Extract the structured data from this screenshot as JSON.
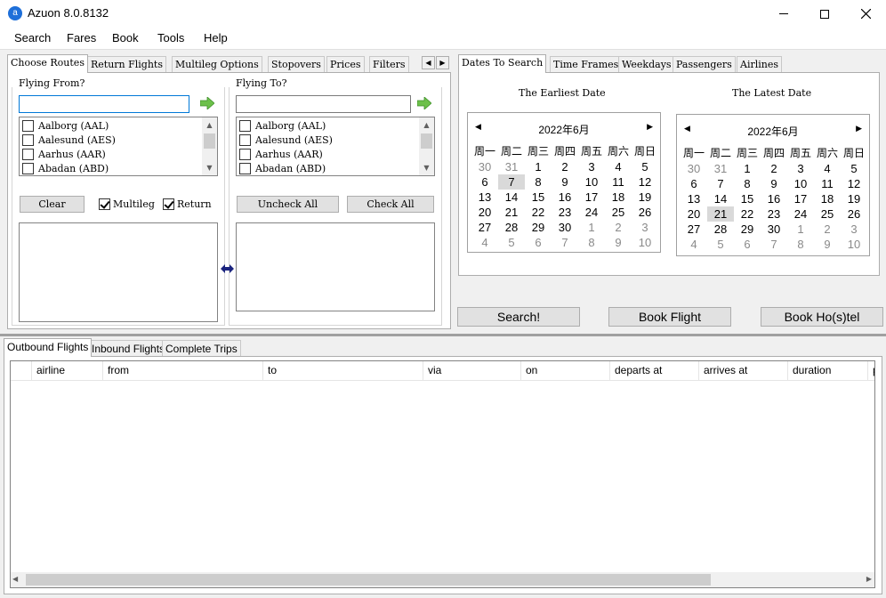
{
  "window": {
    "title": "Azuon 8.0.8132",
    "app_icon_glyph": "a",
    "controls": [
      "minimize-icon",
      "maximize-icon",
      "close-icon"
    ]
  },
  "menu": [
    "Search",
    "Fares",
    "Book",
    "Tools",
    "Help"
  ],
  "left_tabs": [
    "Choose Routes",
    "Return Flights",
    "Multileg Options",
    "Stopovers",
    "Prices",
    "Filters"
  ],
  "right_tabs": [
    "Dates To Search",
    "Time Frames",
    "Weekdays",
    "Passengers",
    "Airlines"
  ],
  "routes": {
    "from_label": "Flying From?",
    "to_label": "Flying To?",
    "from_value": "",
    "to_value": "",
    "airports": [
      "Aalborg (AAL)",
      "Aalesund (AES)",
      "Aarhus (AAR)",
      "Abadan (ABD)"
    ],
    "clear_label": "Clear",
    "multileg_label": "Multileg",
    "multileg_checked": true,
    "return_label": "Return",
    "return_checked": true,
    "uncheck_all_label": "Uncheck All",
    "check_all_label": "Check All",
    "arrow_color": "#4caf50",
    "swap_color": "#1a237e"
  },
  "dates": {
    "earliest_label": "The Earliest Date",
    "latest_label": "The Latest Date",
    "earliest": {
      "month_label": "2022年6月",
      "weekdays": [
        "周一",
        "周二",
        "周三",
        "周四",
        "周五",
        "周六",
        "周日"
      ],
      "days": [
        [
          "30",
          "31",
          "1",
          "2",
          "3",
          "4",
          "5"
        ],
        [
          "6",
          "7",
          "8",
          "9",
          "10",
          "11",
          "12"
        ],
        [
          "13",
          "14",
          "15",
          "16",
          "17",
          "18",
          "19"
        ],
        [
          "20",
          "21",
          "22",
          "23",
          "24",
          "25",
          "26"
        ],
        [
          "27",
          "28",
          "29",
          "30",
          "1",
          "2",
          "3"
        ],
        [
          "4",
          "5",
          "6",
          "7",
          "8",
          "9",
          "10"
        ]
      ],
      "selected": "7"
    },
    "latest": {
      "month_label": "2022年6月",
      "weekdays": [
        "周一",
        "周二",
        "周三",
        "周四",
        "周五",
        "周六",
        "周日"
      ],
      "days": [
        [
          "30",
          "31",
          "1",
          "2",
          "3",
          "4",
          "5"
        ],
        [
          "6",
          "7",
          "8",
          "9",
          "10",
          "11",
          "12"
        ],
        [
          "13",
          "14",
          "15",
          "16",
          "17",
          "18",
          "19"
        ],
        [
          "20",
          "21",
          "22",
          "23",
          "24",
          "25",
          "26"
        ],
        [
          "27",
          "28",
          "29",
          "30",
          "1",
          "2",
          "3"
        ],
        [
          "4",
          "5",
          "6",
          "7",
          "8",
          "9",
          "10"
        ]
      ],
      "selected": "21"
    }
  },
  "actions": {
    "search_label": "Search!",
    "book_flight_label": "Book Flight",
    "book_hostel_label": "Book Ho(s)tel"
  },
  "result_tabs": [
    "Outbound Flights",
    "Inbound Flights",
    "Complete Trips"
  ],
  "results": {
    "columns": [
      "airline",
      "from",
      "to",
      "via",
      "on",
      "departs at",
      "arrives at",
      "duration",
      "p"
    ],
    "rows": []
  }
}
